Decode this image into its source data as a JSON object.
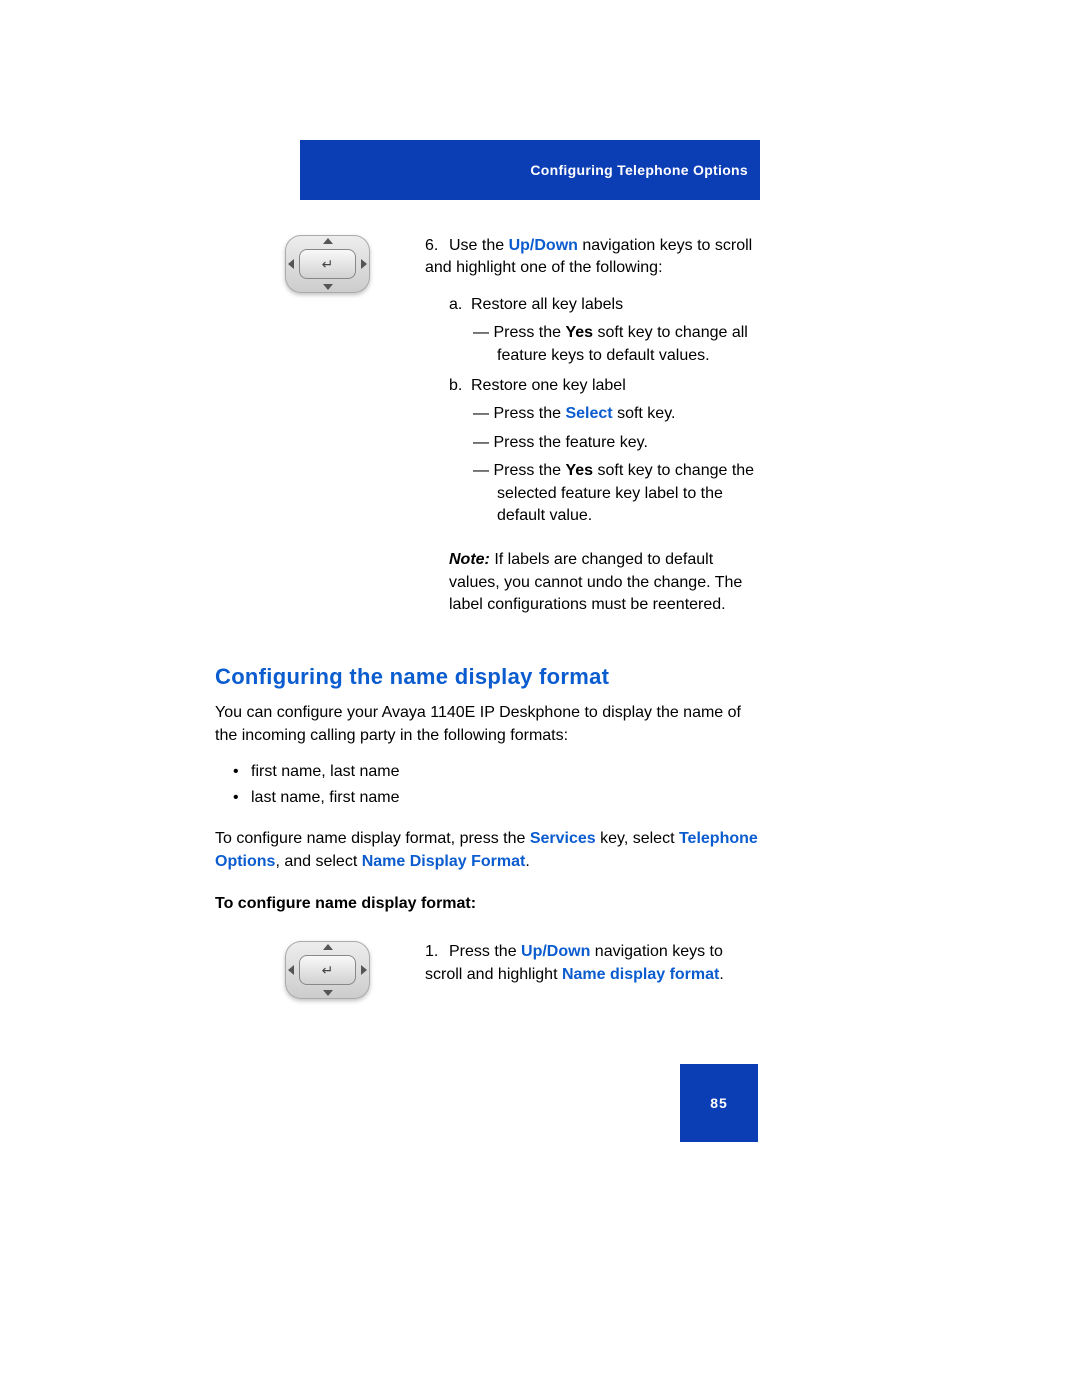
{
  "header": {
    "title": "Configuring Telephone Options"
  },
  "step6": {
    "number": "6.",
    "intro_pre": "Use the ",
    "intro_key": "Up/Down",
    "intro_post": " navigation keys to scroll and highlight one of the following:",
    "a": {
      "letter": "a.",
      "label": "Restore all key labels",
      "d1_pre": "Press the ",
      "d1_key": "Yes",
      "d1_post": " soft key to change all feature keys to default values."
    },
    "b": {
      "letter": "b.",
      "label": "Restore one key label",
      "d1_pre": "Press the ",
      "d1_key": "Select",
      "d1_post": " soft key.",
      "d2": "Press the feature key.",
      "d3_pre": "Press the ",
      "d3_key": "Yes",
      "d3_post": " soft key to change the selected feature key label to the default value."
    },
    "note_label": "Note:",
    "note_text": " If labels are changed to default values, you cannot undo the change. The label configurations must be reentered."
  },
  "section": {
    "heading": "Configuring the name display format",
    "intro": "You can configure your Avaya 1140E IP Deskphone to display the name of the incoming calling party in the following formats:",
    "bullets": [
      "first name, last name",
      "last name, first name"
    ],
    "config_line": {
      "p1": "To configure name display format, press the ",
      "k1": "Services",
      "p2": " key, select ",
      "k2": "Telephone Options",
      "p3": ", and select ",
      "k3": "Name Display Format",
      "p4": "."
    },
    "sub_heading": "To configure name display format:",
    "step1": {
      "number": "1.",
      "pre": "Press the ",
      "key": "Up/Down",
      "mid": " navigation keys to scroll and highlight ",
      "key2": "Name display format",
      "post": "."
    }
  },
  "page_number": "85"
}
